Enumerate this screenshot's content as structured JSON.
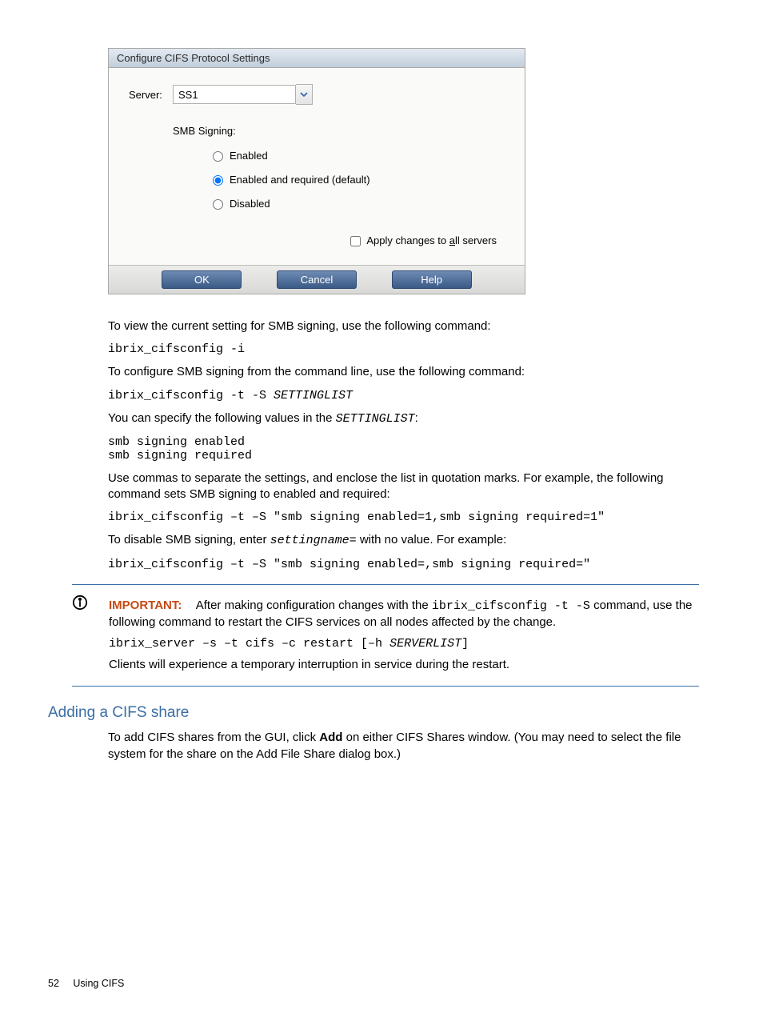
{
  "dialog": {
    "title": "Configure CIFS Protocol Settings",
    "server_label": "Server:",
    "server_value": "SS1",
    "group_label": "SMB Signing:",
    "opt_enabled": "Enabled",
    "opt_required": "Enabled and required (default)",
    "opt_disabled": "Disabled",
    "apply_all_pre": "Apply changes to ",
    "apply_all_u": "a",
    "apply_all_post": "ll servers",
    "btn_ok": "OK",
    "btn_cancel": "Cancel",
    "btn_help": "Help"
  },
  "body": {
    "p1": "To view the current setting for SMB signing, use the following command:",
    "c1": "ibrix_cifsconfig -i",
    "p2": "To configure SMB signing from the command line, use the following command:",
    "c2a": "ibrix_cifsconfig -t -S ",
    "c2b": "SETTINGLIST",
    "p3a": "You can specify the following values in the ",
    "p3code": "SETTINGLIST",
    "p3b": ":",
    "c3": "smb signing enabled\nsmb signing required",
    "p4": "Use commas to separate the settings, and enclose the list in quotation marks. For example, the following command sets SMB signing to enabled and required:",
    "c4": "ibrix_cifsconfig –t –S \"smb signing enabled=1,smb signing required=1\"",
    "p5a": "To disable SMB signing, enter ",
    "p5code": "settingname=",
    "p5b": " with no value. For example:",
    "c5": "ibrix_cifsconfig –t –S \"smb signing enabled=,smb signing required=\""
  },
  "important": {
    "label": "IMPORTANT:",
    "t1a": "After making configuration changes with the ",
    "t1code": "ibrix_cifsconfig -t -S",
    "t1b": " command, use the following command to restart the CIFS services on all nodes affected by the change.",
    "cmd_a": "ibrix_server –s –t cifs –c restart [–h ",
    "cmd_b": "SERVERLIST",
    "cmd_c": "]",
    "t2": "Clients will experience a temporary interruption in service during the restart."
  },
  "section": {
    "heading": "Adding a CIFS share",
    "p1a": "To add CIFS shares from the GUI, click ",
    "p1bold": "Add",
    "p1b": " on either CIFS Shares window. (You may need to select the file system for the share on the Add File Share dialog box.)"
  },
  "footer": {
    "page": "52",
    "chapter": "Using CIFS"
  }
}
